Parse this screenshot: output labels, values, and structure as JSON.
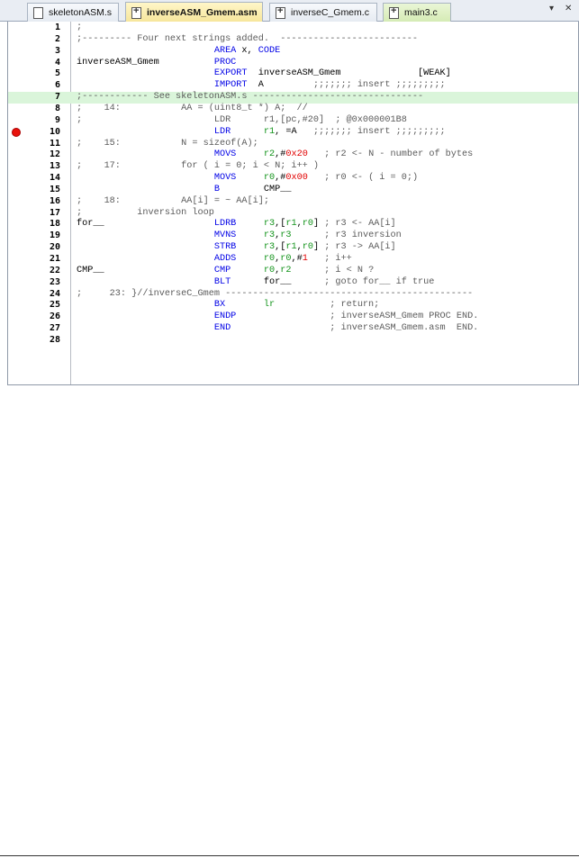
{
  "tabs": [
    {
      "label": "skeletonASM.s",
      "icon": "file-icon",
      "active": false
    },
    {
      "label": "inverseASM_Gmem.asm",
      "icon": "file-plus-icon",
      "active": true
    },
    {
      "label": "inverseC_Gmem.c",
      "icon": "file-plus-icon",
      "active": false
    },
    {
      "label": "main3.c",
      "icon": "file-plus-icon",
      "active": false
    }
  ],
  "tab_controls": {
    "dropdown": "▾",
    "close": "✕"
  },
  "colors": {
    "comment": "#5b5b5b",
    "keyword": "#0000e6",
    "register": "#14941c",
    "number": "#e10000",
    "highlight": "#daf5da",
    "breakpoint": "#e8120c"
  },
  "breakpoint_line": 10,
  "highlight_line": 7,
  "lines": [
    {
      "n": "1",
      "seg": [
        [
          "cmt",
          ";"
        ]
      ]
    },
    {
      "n": "2",
      "seg": [
        [
          "cmt",
          ";--------- Four next strings added.  -------------------------"
        ]
      ]
    },
    {
      "n": "3",
      "seg": [
        [
          "txt",
          "                         "
        ],
        [
          "kw",
          "AREA"
        ],
        [
          "txt",
          " x, "
        ],
        [
          "kw",
          "CODE"
        ]
      ]
    },
    {
      "n": "4",
      "seg": [
        [
          "txt",
          "inverseASM_Gmem          "
        ],
        [
          "kw",
          "PROC"
        ]
      ]
    },
    {
      "n": "5",
      "seg": [
        [
          "txt",
          "                         "
        ],
        [
          "kw",
          "EXPORT"
        ],
        [
          "txt",
          "  inverseASM_Gmem              [WEAK]"
        ]
      ]
    },
    {
      "n": "6",
      "seg": [
        [
          "txt",
          "                         "
        ],
        [
          "kw",
          "IMPORT"
        ],
        [
          "txt",
          "  A         "
        ],
        [
          "cmt",
          ";;;;;;; insert ;;;;;;;;;"
        ]
      ]
    },
    {
      "n": "7",
      "seg": [
        [
          "cmt",
          ";------------ See skeletonASM.s -------------------------------"
        ]
      ]
    },
    {
      "n": "8",
      "seg": [
        [
          "cmt",
          ";    14:           AA = (uint8_t *) A;  //"
        ]
      ]
    },
    {
      "n": "9",
      "seg": [
        [
          "cmt",
          ";                        LDR      r1,[pc,#20]  ; @0x000001B8"
        ]
      ]
    },
    {
      "n": "10",
      "seg": [
        [
          "txt",
          "                         "
        ],
        [
          "kw",
          "LDR"
        ],
        [
          "txt",
          "      "
        ],
        [
          "reg",
          "r1"
        ],
        [
          "txt",
          ", =A   "
        ],
        [
          "cmt",
          ";;;;;;; insert ;;;;;;;;;"
        ]
      ]
    },
    {
      "n": "11",
      "seg": [
        [
          "cmt",
          ";    15:           N = sizeof(A);"
        ]
      ]
    },
    {
      "n": "12",
      "seg": [
        [
          "txt",
          "                         "
        ],
        [
          "kw",
          "MOVS"
        ],
        [
          "txt",
          "     "
        ],
        [
          "reg",
          "r2"
        ],
        [
          "txt",
          ",#"
        ],
        [
          "num",
          "0x20"
        ],
        [
          "txt",
          "   "
        ],
        [
          "cmt",
          "; r2 <- N - number of bytes"
        ]
      ]
    },
    {
      "n": "13",
      "seg": [
        [
          "cmt",
          ";    17:           for ( i = 0; i < N; i++ )"
        ]
      ]
    },
    {
      "n": "14",
      "seg": [
        [
          "txt",
          "                         "
        ],
        [
          "kw",
          "MOVS"
        ],
        [
          "txt",
          "     "
        ],
        [
          "reg",
          "r0"
        ],
        [
          "txt",
          ",#"
        ],
        [
          "num",
          "0x00"
        ],
        [
          "txt",
          "   "
        ],
        [
          "cmt",
          "; r0 <- ( i = 0;)"
        ]
      ]
    },
    {
      "n": "15",
      "seg": [
        [
          "txt",
          "                         "
        ],
        [
          "kw",
          "B"
        ],
        [
          "txt",
          "        CMP__"
        ]
      ]
    },
    {
      "n": "16",
      "seg": [
        [
          "cmt",
          ";    18:           AA[i] = ~ AA[i];"
        ]
      ]
    },
    {
      "n": "17",
      "seg": [
        [
          "cmt",
          ";          inversion loop"
        ]
      ]
    },
    {
      "n": "18",
      "seg": [
        [
          "txt",
          "for__                    "
        ],
        [
          "kw",
          "LDRB"
        ],
        [
          "txt",
          "     "
        ],
        [
          "reg",
          "r3"
        ],
        [
          "txt",
          ",["
        ],
        [
          "reg",
          "r1"
        ],
        [
          "txt",
          ","
        ],
        [
          "reg",
          "r0"
        ],
        [
          "txt",
          "] "
        ],
        [
          "cmt",
          "; r3 <- AA[i]"
        ]
      ]
    },
    {
      "n": "19",
      "seg": [
        [
          "txt",
          "                         "
        ],
        [
          "kw",
          "MVNS"
        ],
        [
          "txt",
          "     "
        ],
        [
          "reg",
          "r3"
        ],
        [
          "txt",
          ","
        ],
        [
          "reg",
          "r3"
        ],
        [
          "txt",
          "      "
        ],
        [
          "cmt",
          "; r3 inversion"
        ]
      ]
    },
    {
      "n": "20",
      "seg": [
        [
          "txt",
          "                         "
        ],
        [
          "kw",
          "STRB"
        ],
        [
          "txt",
          "     "
        ],
        [
          "reg",
          "r3"
        ],
        [
          "txt",
          ",["
        ],
        [
          "reg",
          "r1"
        ],
        [
          "txt",
          ","
        ],
        [
          "reg",
          "r0"
        ],
        [
          "txt",
          "] "
        ],
        [
          "cmt",
          "; r3 -> AA[i]"
        ]
      ]
    },
    {
      "n": "21",
      "seg": [
        [
          "txt",
          "                         "
        ],
        [
          "kw",
          "ADDS"
        ],
        [
          "txt",
          "     "
        ],
        [
          "reg",
          "r0"
        ],
        [
          "txt",
          ","
        ],
        [
          "reg",
          "r0"
        ],
        [
          "txt",
          ",#"
        ],
        [
          "num",
          "1"
        ],
        [
          "txt",
          "   "
        ],
        [
          "cmt",
          "; i++"
        ]
      ]
    },
    {
      "n": "22",
      "seg": [
        [
          "txt",
          "CMP__                    "
        ],
        [
          "kw",
          "CMP"
        ],
        [
          "txt",
          "      "
        ],
        [
          "reg",
          "r0"
        ],
        [
          "txt",
          ","
        ],
        [
          "reg",
          "r2"
        ],
        [
          "txt",
          "      "
        ],
        [
          "cmt",
          "; i < N ?"
        ]
      ]
    },
    {
      "n": "23",
      "seg": [
        [
          "txt",
          "                         "
        ],
        [
          "kw",
          "BLT"
        ],
        [
          "txt",
          "      for__      "
        ],
        [
          "cmt",
          "; goto for__ if true"
        ]
      ]
    },
    {
      "n": "24",
      "seg": [
        [
          "cmt",
          ";     23: }//inverseC_Gmem ---------------------------------------------"
        ]
      ]
    },
    {
      "n": "25",
      "seg": [
        [
          "txt",
          "                         "
        ],
        [
          "kw",
          "BX"
        ],
        [
          "txt",
          "       "
        ],
        [
          "reg",
          "lr"
        ],
        [
          "txt",
          "          "
        ],
        [
          "cmt",
          "; return;"
        ]
      ]
    },
    {
      "n": "26",
      "seg": [
        [
          "txt",
          "                         "
        ],
        [
          "kw",
          "ENDP"
        ],
        [
          "txt",
          "                 "
        ],
        [
          "cmt",
          "; inverseASM_Gmem PROC END."
        ]
      ]
    },
    {
      "n": "27",
      "seg": [
        [
          "txt",
          "                         "
        ],
        [
          "kw",
          "END"
        ],
        [
          "txt",
          "                  "
        ],
        [
          "cmt",
          "; inverseASM_Gmem.asm  END."
        ]
      ]
    },
    {
      "n": "28",
      "seg": [
        [
          "txt",
          ""
        ]
      ]
    }
  ]
}
